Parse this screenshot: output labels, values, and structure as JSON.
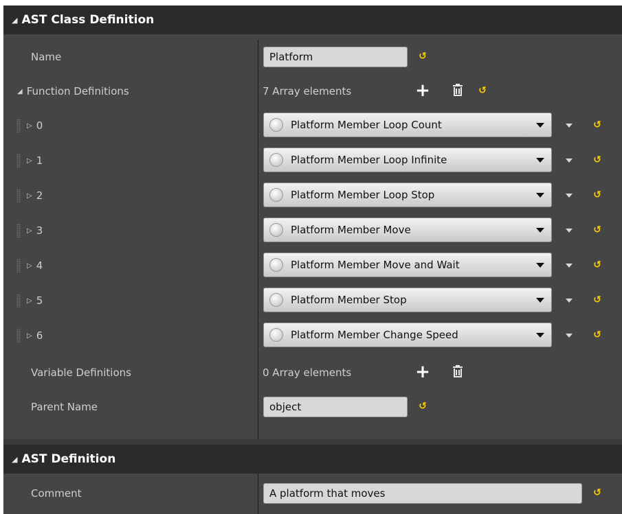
{
  "ast_class_definition": {
    "header": "AST Class Definition",
    "name_label": "Name",
    "name_value": "Platform",
    "function_definitions_label": "Function Definitions",
    "function_definitions_count": "7 Array elements",
    "elements": [
      {
        "index": "0",
        "value": "Platform Member Loop Count"
      },
      {
        "index": "1",
        "value": "Platform Member Loop Infinite"
      },
      {
        "index": "2",
        "value": "Platform Member Loop Stop"
      },
      {
        "index": "3",
        "value": "Platform Member Move"
      },
      {
        "index": "4",
        "value": "Platform Member Move and Wait"
      },
      {
        "index": "5",
        "value": "Platform Member Stop"
      },
      {
        "index": "6",
        "value": "Platform Member Change Speed"
      }
    ],
    "variable_definitions_label": "Variable Definitions",
    "variable_definitions_count": "0 Array elements",
    "parent_name_label": "Parent Name",
    "parent_name_value": "object"
  },
  "ast_definition": {
    "header": "AST Definition",
    "comment_label": "Comment",
    "comment_value": "A platform that moves"
  },
  "icons": {
    "expand": "triangle-down-icon",
    "collapsed": "triangle-right-icon",
    "reset": "reset-to-default-icon",
    "add": "plus-icon",
    "delete": "trash-icon",
    "grip": "drag-grip-icon"
  },
  "colors": {
    "panel_bg": "#454545",
    "header_bg": "#2b2b2b",
    "reset_accent": "#ffd000"
  }
}
